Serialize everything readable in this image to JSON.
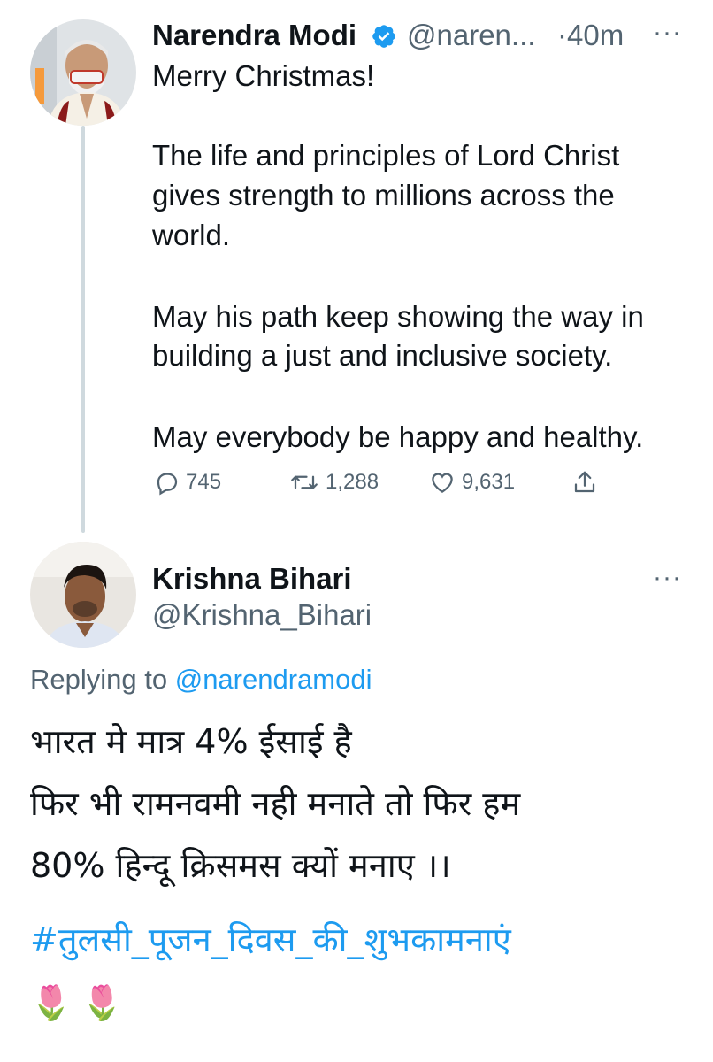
{
  "tweet": {
    "author_name": "Narendra Modi",
    "handle": "@naren...",
    "time": "·40m",
    "more": "···",
    "lines": [
      "Merry Christmas!",
      "The life and principles of Lord Christ",
      "gives strength to millions across the",
      "world.",
      "May his path keep showing the way in",
      "building a just and inclusive society.",
      "May everybody be happy and healthy."
    ],
    "replies": "745",
    "retweets": "1,288",
    "likes": "9,631"
  },
  "reply": {
    "author_name": "Krishna Bihari",
    "handle": "@Krishna_Bihari",
    "more": "···",
    "replying_prefix": "Replying to",
    "replying_to": "@narendramodi",
    "lines": [
      "भारत मे मात्र 4% ईसाई  है",
      "फिर भी रामनवमी नही मनाते तो फिर हम",
      "80% हिन्दू क्रिसमस क्यों मनाए ।।"
    ],
    "hashtag": "#तुलसी_पूजन_दिवस_की_शुभकामनाएं",
    "emoji": "🌷 🌷"
  },
  "colors": {
    "link": "#1d9bf0",
    "verified": "#1d9bf0",
    "muted": "#536471"
  },
  "icons": [
    "reply-icon",
    "retweet-icon",
    "like-icon",
    "share-icon",
    "verified-badge-icon"
  ]
}
